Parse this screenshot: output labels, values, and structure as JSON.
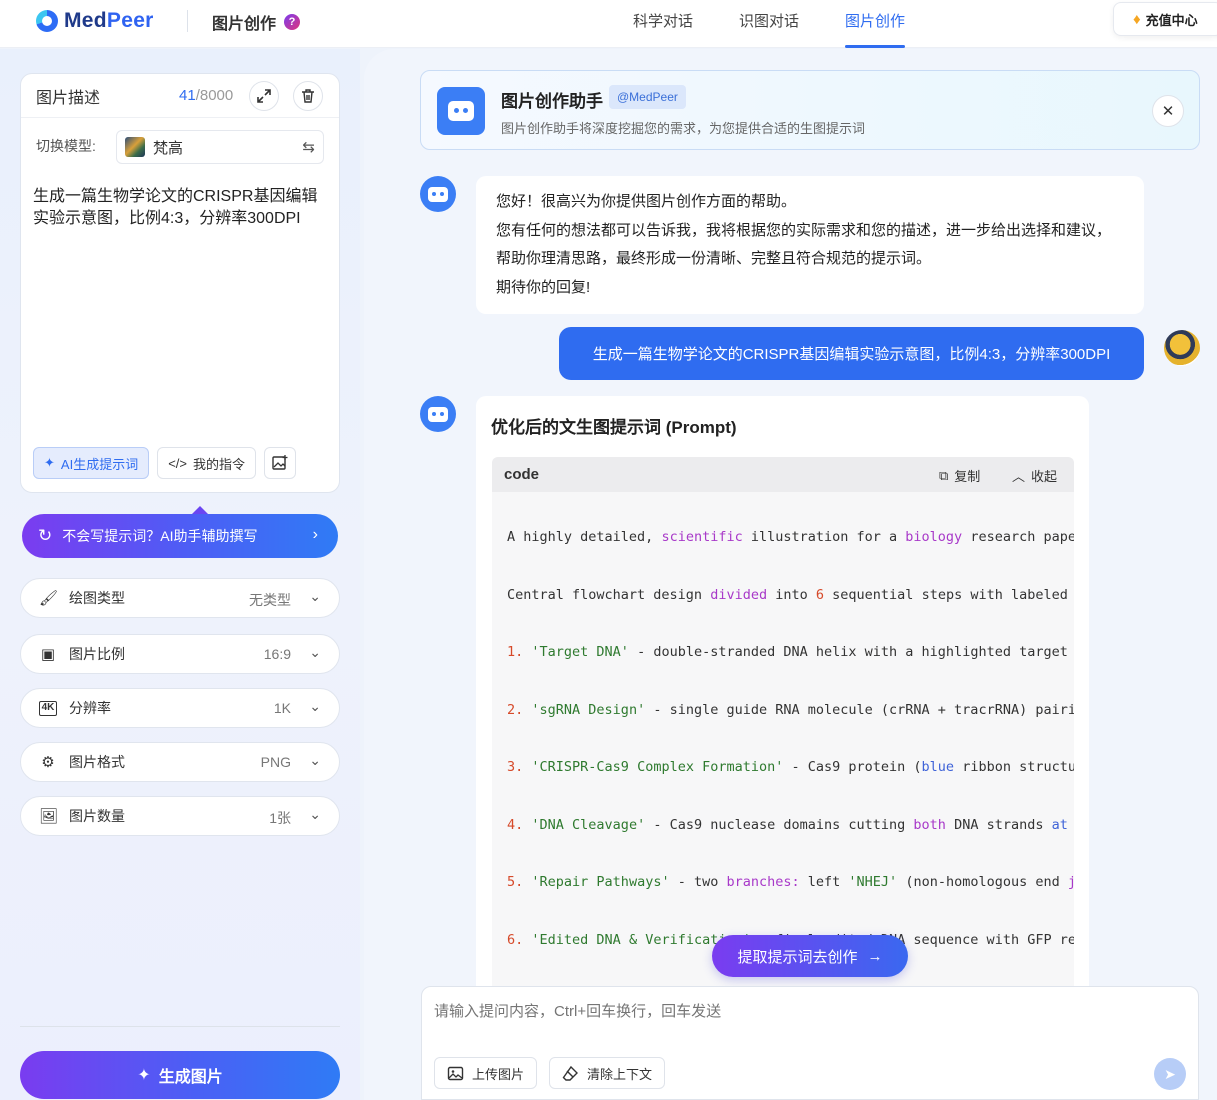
{
  "header": {
    "logo_text_a": "Med",
    "logo_text_b": "Peer",
    "app_title": "图片创作",
    "help_icon": "?",
    "tabs": [
      {
        "label": "科学对话",
        "active": false
      },
      {
        "label": "识图对话",
        "active": false
      },
      {
        "label": "图片创作",
        "active": true
      }
    ],
    "recharge_label": "充值中心"
  },
  "sidebar": {
    "desc_title": "图片描述",
    "char_count": "41",
    "char_limit": "/8000",
    "model_label": "切换模型:",
    "model_name": "梵高",
    "description": "生成一篇生物学论文的CRISPR基因编辑实验示意图，比例4:3，分辨率300DPI",
    "ai_prompt_label": "AI生成提示词",
    "my_commands_label": "我的指令",
    "assist_label": "不会写提示词？AI助手辅助撰写",
    "options": [
      {
        "label": "绘图类型",
        "value": "无类型",
        "icon": "brush-icon"
      },
      {
        "label": "图片比例",
        "value": "16:9",
        "icon": "ratio-icon"
      },
      {
        "label": "分辨率",
        "value": "1K",
        "icon": "4k-icon"
      },
      {
        "label": "图片格式",
        "value": "PNG",
        "icon": "format-icon"
      },
      {
        "label": "图片数量",
        "value": "1张",
        "icon": "images-icon"
      }
    ],
    "generate_label": "生成图片"
  },
  "chat": {
    "assistant_name": "图片创作助手",
    "assistant_tag": "@MedPeer",
    "assistant_desc": "图片创作助手将深度挖掘您的需求，为您提供合适的生图提示词",
    "bot_greeting": [
      "您好！很高兴为你提供图片创作方面的帮助。",
      "您有任何的想法都可以告诉我，我将根据您的实际需求和您的描述，进一步给出选择和建议，帮助你理清思路，最终形成一份清晰、完整且符合规范的提示词。",
      "期待你的回复!"
    ],
    "user_message": "生成一篇生物学论文的CRISPR基因编辑实验示意图，比例4:3，分辨率300DPI",
    "prompt_title": "优化后的文生图提示词 (Prompt)",
    "code_lang": "code",
    "copy_label": "复制",
    "collapse_label": "收起",
    "extract_label": "提取提示词去创作",
    "input_placeholder": "请输入提问内容，Ctrl+回车换行，回车发送",
    "upload_label": "上传图片",
    "clear_label": "清除上下文"
  },
  "colors": {
    "accent": "#2f6cf0",
    "gradient_start": "#7a3cf0",
    "gradient_end": "#2f7bf5"
  }
}
